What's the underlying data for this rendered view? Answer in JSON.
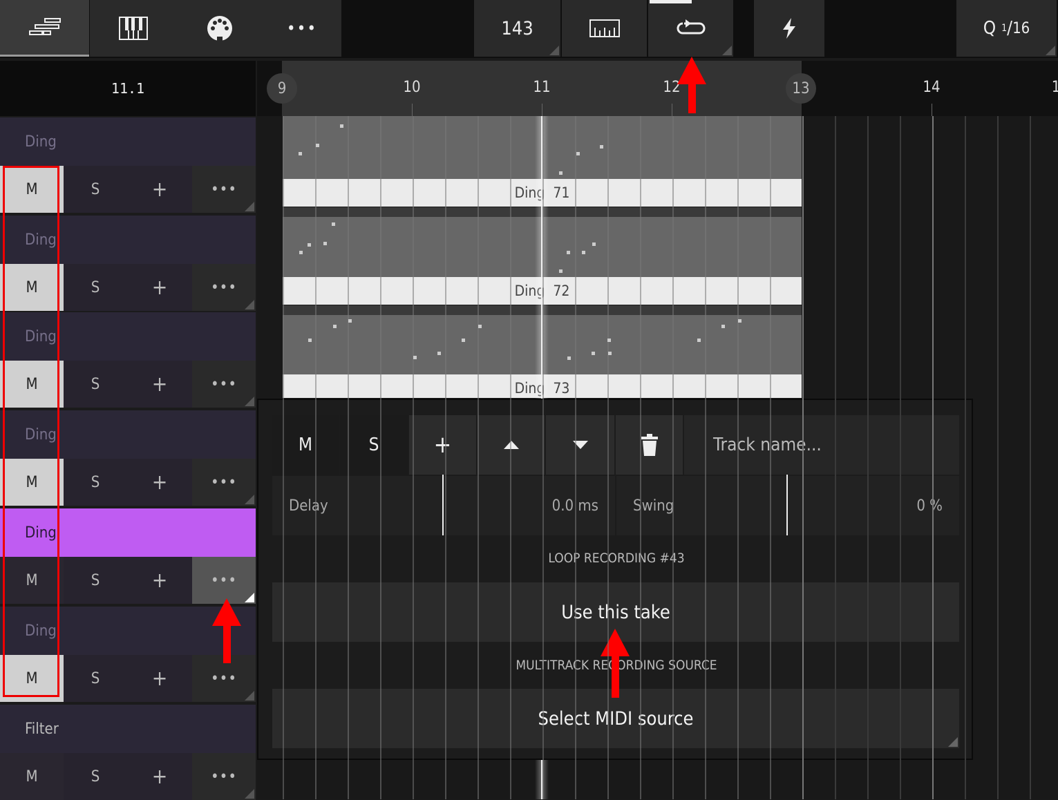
{
  "toolbar": {
    "tempo": "143",
    "quantize_prefix": "Q",
    "quantize_num": "1",
    "quantize_den": "16"
  },
  "position": "11.1",
  "ruler": {
    "marks": [
      "9",
      "10",
      "11",
      "12",
      "13",
      "14",
      "1"
    ]
  },
  "tracks": [
    {
      "name": "Ding",
      "mute": "M",
      "solo": "S",
      "add": "+",
      "more": "•••"
    },
    {
      "name": "Ding",
      "mute": "M",
      "solo": "S",
      "add": "+",
      "more": "•••"
    },
    {
      "name": "Ding",
      "mute": "M",
      "solo": "S",
      "add": "+",
      "more": "•••"
    },
    {
      "name": "Ding",
      "mute": "M",
      "solo": "S",
      "add": "+",
      "more": "•••"
    },
    {
      "name": "Ding",
      "mute": "M",
      "solo": "S",
      "add": "+",
      "more": "•••"
    },
    {
      "name": "Ding",
      "mute": "M",
      "solo": "S",
      "add": "+",
      "more": "•••"
    },
    {
      "name": "Filter",
      "mute": "M",
      "solo": "S",
      "add": "+",
      "more": "•••"
    }
  ],
  "clips": [
    {
      "name": "Ding",
      "number": "71"
    },
    {
      "name": "Ding",
      "number": "72"
    },
    {
      "name": "Ding",
      "number": "73"
    }
  ],
  "popup": {
    "mute": "M",
    "solo": "S",
    "add": "+",
    "track_name_placeholder": "Track name...",
    "delay_label": "Delay",
    "delay_value": "0.0 ms",
    "swing_label": "Swing",
    "swing_value": "0 %",
    "loop_section": "LOOP RECORDING #43",
    "use_take": "Use this take",
    "source_section": "MULTITRACK RECORDING SOURCE",
    "select_midi": "Select MIDI source"
  },
  "colors": {
    "active_track": "#bf5cf2",
    "annotation": "#ff0000"
  }
}
